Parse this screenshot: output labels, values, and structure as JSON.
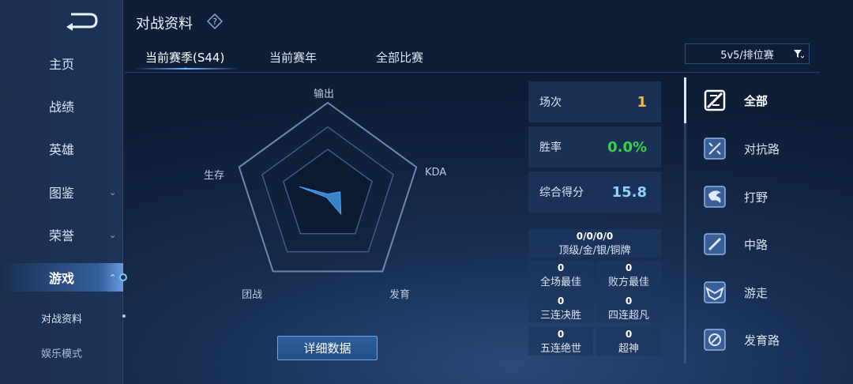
{
  "sidebar": {
    "items": [
      {
        "label": "主页"
      },
      {
        "label": "战绩"
      },
      {
        "label": "英雄"
      },
      {
        "label": "图鉴"
      },
      {
        "label": "荣誉"
      },
      {
        "label": "游戏"
      }
    ],
    "sub_items": [
      {
        "label": "对战资料"
      },
      {
        "label": "娱乐模式"
      }
    ]
  },
  "header": {
    "title": "对战资料"
  },
  "tabs": [
    {
      "label": "当前赛季(S44)"
    },
    {
      "label": "当前赛年"
    },
    {
      "label": "全部比赛"
    }
  ],
  "mode_select": {
    "value": "5v5/排位赛"
  },
  "radar": {
    "axes": [
      "输出",
      "KDA",
      "发育",
      "团战",
      "生存"
    ],
    "values": [
      0.02,
      0.14,
      0.24,
      0.02,
      0.32
    ]
  },
  "detail_button": {
    "label": "详细数据"
  },
  "stats": [
    {
      "label": "场次",
      "value": "1",
      "color": "#f2b84a"
    },
    {
      "label": "胜率",
      "value": "0.0%",
      "color": "#39d24a"
    },
    {
      "label": "综合得分",
      "value": "15.8",
      "color": "#8fd0ff"
    }
  ],
  "honors": {
    "medals": {
      "value": "0/0/0/0",
      "label": "顶级/金/银/铜牌"
    },
    "cells": [
      {
        "value": "0",
        "label": "全场最佳"
      },
      {
        "value": "0",
        "label": "败方最佳"
      },
      {
        "value": "0",
        "label": "三连决胜"
      },
      {
        "value": "0",
        "label": "四连超凡"
      },
      {
        "value": "0",
        "label": "五连绝世"
      },
      {
        "value": "0",
        "label": "超神"
      }
    ]
  },
  "roles": [
    {
      "label": "全部",
      "icon": "all-roles-icon"
    },
    {
      "label": "对抗路",
      "icon": "clash-lane-icon"
    },
    {
      "label": "打野",
      "icon": "jungle-icon"
    },
    {
      "label": "中路",
      "icon": "mid-lane-icon"
    },
    {
      "label": "游走",
      "icon": "roam-icon"
    },
    {
      "label": "发育路",
      "icon": "farm-lane-icon"
    }
  ],
  "colors": {
    "accent": "#6fb4ff",
    "background": "#152a4a"
  }
}
